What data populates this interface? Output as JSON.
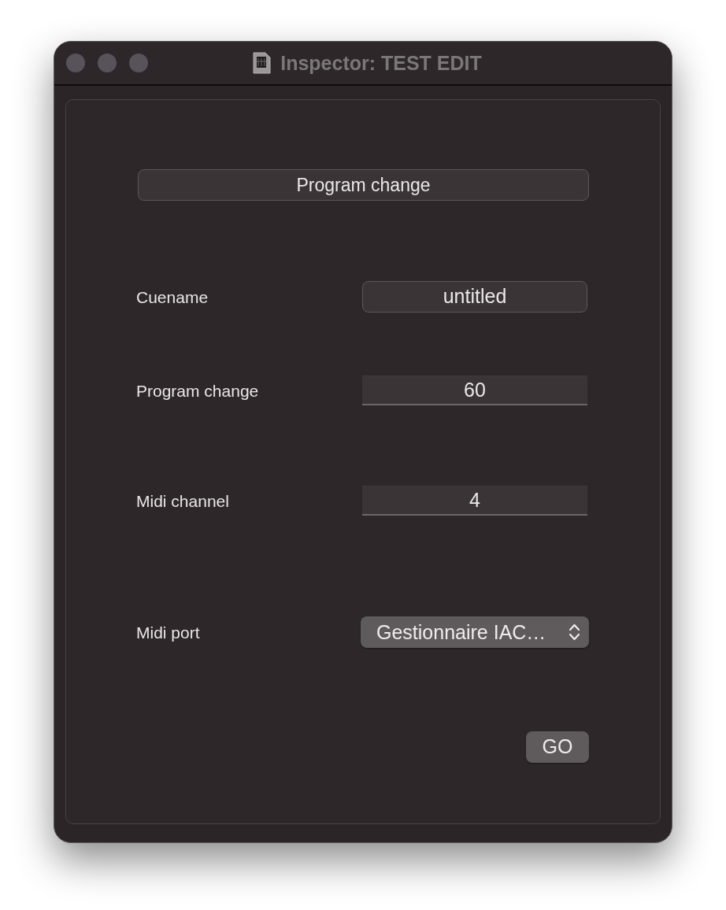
{
  "window": {
    "title": "Inspector: TEST EDIT"
  },
  "header_button": {
    "label": "Program change"
  },
  "fields": [
    {
      "kind": "button",
      "label": "Cuename",
      "value": "untitled"
    },
    {
      "kind": "text",
      "label": "Program change",
      "value": "60"
    },
    {
      "kind": "text",
      "label": "Midi channel",
      "value": "4"
    },
    {
      "kind": "popup",
      "label": "Midi port",
      "value": "Gestionnaire IAC…"
    }
  ],
  "buttons": [
    {
      "label": "GO"
    }
  ]
}
